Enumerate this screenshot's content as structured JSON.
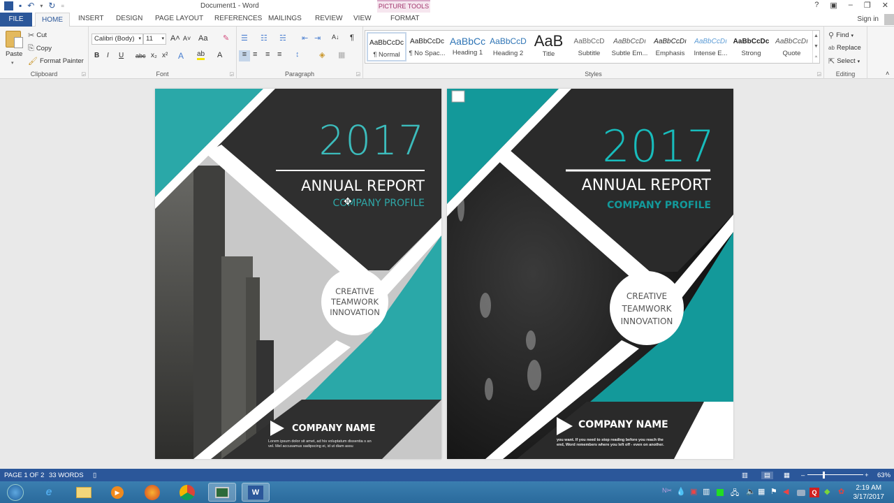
{
  "window": {
    "title": "Document1 - Word",
    "contextual_tab_group": "PICTURE TOOLS",
    "controls": {
      "help": "?",
      "ribbon_display": "▣",
      "minimize": "–",
      "restore": "❐",
      "close": "✕"
    },
    "sign_in": "Sign in"
  },
  "quick_access": {
    "app_icon": "W",
    "save": "💾",
    "undo": "↶",
    "undo_dropdown": "▾",
    "redo": "↻",
    "customize": "="
  },
  "tabs": {
    "file": "FILE",
    "items": [
      "HOME",
      "INSERT",
      "DESIGN",
      "PAGE LAYOUT",
      "REFERENCES",
      "MAILINGS",
      "REVIEW",
      "VIEW",
      "FORMAT"
    ],
    "active": "HOME"
  },
  "ribbon": {
    "clipboard": {
      "label": "Clipboard",
      "paste": "Paste",
      "cut": "Cut",
      "copy": "Copy",
      "format_painter": "Format Painter"
    },
    "font": {
      "label": "Font",
      "font_name": "Calibri (Body)",
      "font_size": "11",
      "grow": "A˄",
      "shrink": "A˅",
      "change_case": "Aa",
      "clear": "✎",
      "bold": "B",
      "italic": "I",
      "underline": "U",
      "strike": "abc",
      "subscript": "x₂",
      "superscript": "x²",
      "text_effects": "A",
      "highlight": "ab",
      "font_color": "A",
      "highlight_color": "#f5e400",
      "font_color_bar": "#d00000"
    },
    "paragraph": {
      "label": "Paragraph",
      "bullets": "☰",
      "numbering": "☷",
      "multilevel": "☵",
      "decrease_indent": "⇤",
      "increase_indent": "⇥",
      "sort": "A↓",
      "show_marks": "¶",
      "align_left": "≡",
      "center": "≡",
      "align_right": "≡",
      "justify": "≡",
      "line_spacing": "↕",
      "shading": "◈",
      "borders": "▦"
    },
    "styles": {
      "label": "Styles",
      "items": [
        {
          "preview": "AaBbCcDc",
          "name": "¶ Normal",
          "selected": true
        },
        {
          "preview": "AaBbCcDc",
          "name": "¶ No Spac..."
        },
        {
          "preview": "AaBbCc",
          "name": "Heading 1"
        },
        {
          "preview": "AaBbCcD",
          "name": "Heading 2"
        },
        {
          "preview": "AaB",
          "name": "Title"
        },
        {
          "preview": "AaBbCcD",
          "name": "Subtitle"
        },
        {
          "preview": "AaBbCcDı",
          "name": "Subtle Em..."
        },
        {
          "preview": "AaBbCcDı",
          "name": "Emphasis"
        },
        {
          "preview": "AaBbCcDı",
          "name": "Intense E..."
        },
        {
          "preview": "AaBbCcDc",
          "name": "Strong"
        },
        {
          "preview": "AaBbCcDı",
          "name": "Quote"
        }
      ]
    },
    "editing": {
      "label": "Editing",
      "find": "Find",
      "replace": "Replace",
      "select": "Select"
    }
  },
  "document": {
    "pages": [
      {
        "year": "2017",
        "title": "ANNUAL REPORT",
        "subtitle": "COMPANY PROFILE",
        "circle": [
          "CREATIVE",
          "TEAMWORK",
          "INNOVATION"
        ],
        "company": "COMPANY NAME",
        "body": "Lorem ipsum dolor sit amet, ad his voluptatum dissentia s an vel. Mel accusamus sadipscing ei, id ut diam assu",
        "photo": "city-buildings"
      },
      {
        "year": "2017",
        "title": "ANNUAL REPORT",
        "subtitle": "COMPANY PROFILE",
        "circle": [
          "CREATIVE",
          "TEAMWORK",
          "INNOVATION"
        ],
        "company": "COMPANY NAME",
        "body": "you want. If you need to stop reading before you reach the end, Word remembers where you left off - even on another.",
        "photo": "dark-grass"
      }
    ],
    "colors": {
      "teal": "#2aa8a8",
      "teal_dark": "#13999a",
      "charcoal": "#2f2f2f",
      "accent_blue": "#2b579a"
    }
  },
  "status_bar": {
    "page": "PAGE 1 OF 2",
    "words": "33 WORDS",
    "zoom": "63%",
    "zoom_level_percent": 63,
    "zoom_minus": "–",
    "zoom_plus": "+"
  },
  "taskbar": {
    "apps": [
      "windows-start",
      "internet-explorer",
      "file-explorer",
      "media-player",
      "firefox",
      "chrome",
      "task-manager",
      "word"
    ],
    "time": "2:19 AM",
    "date": "3/17/2017"
  }
}
